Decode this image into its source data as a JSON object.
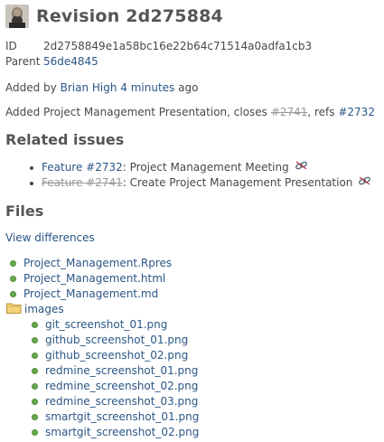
{
  "revision": {
    "title": "Revision 2d275884",
    "id_label": "ID",
    "id_value": "2d2758849e1a58bc16e22b64c71514a0adfa1cb3",
    "parent_label": "Parent",
    "parent_value": "56de4845"
  },
  "added_by": {
    "prefix": "Added by",
    "author": "Brian High",
    "time": "4 minutes",
    "suffix": "ago"
  },
  "message": {
    "text1": "Added Project Management Presentation, closes",
    "closes_ref": "#2741",
    "text2": ", refs",
    "refs_ref": "#2732"
  },
  "related": {
    "heading": "Related issues",
    "items": [
      {
        "link": "Feature #2732",
        "text": ": Project Management Meeting",
        "closed": false,
        "icon": "unlink-icon"
      },
      {
        "link": "Feature #2741",
        "text": ": Create Project Management Presentation",
        "closed": true,
        "icon": "unlink-icon"
      }
    ]
  },
  "files": {
    "heading": "Files",
    "view_diff": "View differences",
    "root": [
      "Project_Management.Rpres",
      "Project_Management.html",
      "Project_Management.md"
    ],
    "folder": "images",
    "folder_files": [
      "git_screenshot_01.png",
      "github_screenshot_01.png",
      "github_screenshot_02.png",
      "redmine_screenshot_01.png",
      "redmine_screenshot_02.png",
      "redmine_screenshot_03.png",
      "smartgit_screenshot_01.png",
      "smartgit_screenshot_02.png"
    ]
  },
  "colors": {
    "link": "#2a5685",
    "closed_link": "#999999",
    "file_dot": "#6aa84f",
    "folder": "#e8c15a"
  }
}
